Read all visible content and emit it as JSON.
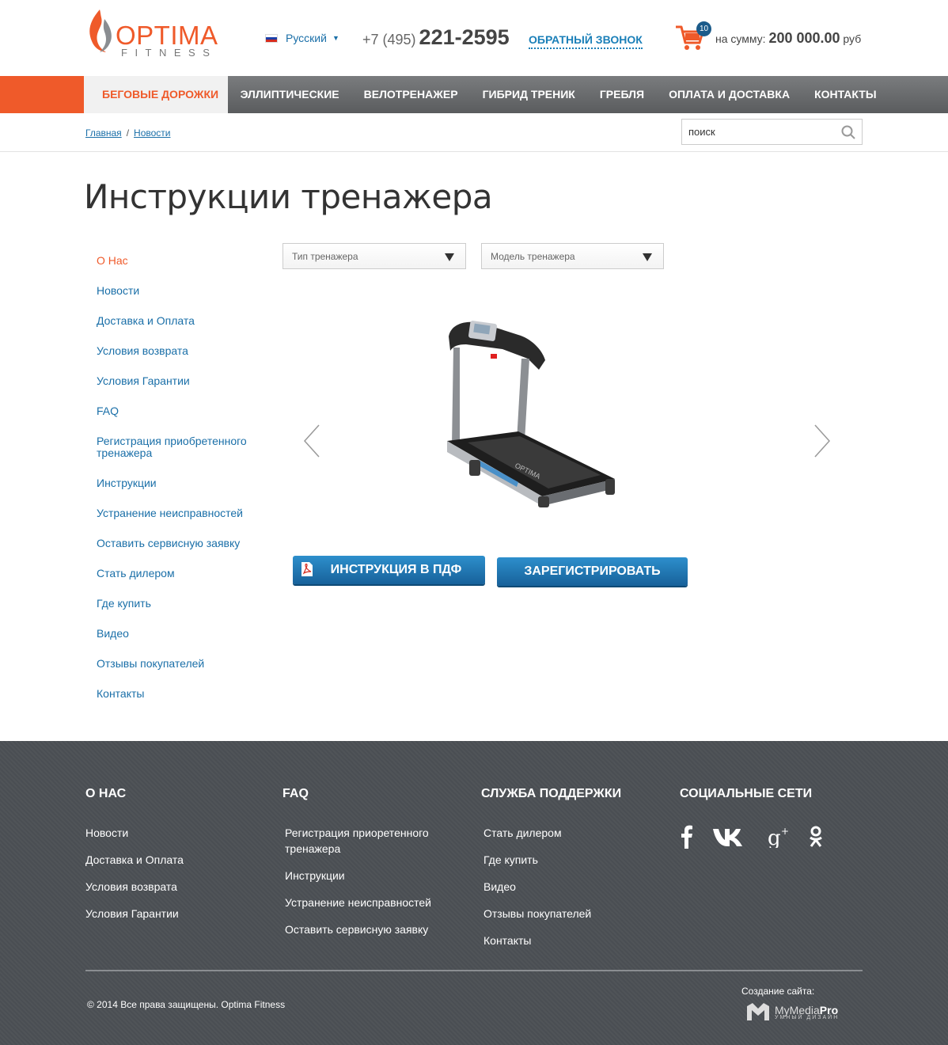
{
  "header": {
    "logo_word": "OPTIMA",
    "logo_sub": "FITNESS",
    "language": "Русский",
    "phone_code": "+7 (495)",
    "phone_number": "221-2595",
    "callback_label": "ОБРАТНЫЙ ЗВОНОК",
    "cart_count": "10",
    "cart_sum_label": "на сумму:",
    "cart_sum_value": "200 000.00",
    "cart_currency": "руб"
  },
  "nav": {
    "items": [
      {
        "label": "БЕГОВЫЕ ДОРОЖКИ",
        "active": true
      },
      {
        "label": "ЭЛЛИПТИЧЕСКИЕ"
      },
      {
        "label": "ВЕЛОТРЕНАЖЕР"
      },
      {
        "label": "ГИБРИД ТРЕНИК"
      },
      {
        "label": "ГРЕБЛЯ"
      },
      {
        "label": "ОПЛАТА И ДОСТАВКА"
      },
      {
        "label": "КОНТАКТЫ"
      }
    ]
  },
  "breadcrumb": {
    "items": [
      "Главная",
      "Новости"
    ],
    "separator": "/"
  },
  "search": {
    "placeholder": "поиск"
  },
  "page": {
    "title": "Инструкции тренажера"
  },
  "sidebar": {
    "items": [
      "О Нас",
      "Новости",
      "Доставка и Оплата",
      "Условия возврата",
      "Условия Гарантии",
      "FAQ",
      "Регистрация приобретенного тренажера",
      "Инструкции",
      "Устранение неисправностей",
      "Оставить сервисную заявку",
      "Стать дилером",
      "Где купить",
      "Видео",
      "Отзывы покупателей",
      "Контакты"
    ]
  },
  "filters": {
    "type_select": "Тип тренажера",
    "model_select": "Модель тренажера"
  },
  "product": {
    "brand_on_deck": "OPTIMA"
  },
  "buttons": {
    "pdf": "ИНСТРУКЦИЯ В ПДФ",
    "register": "ЗАРЕГИСТРИРОВАТЬ"
  },
  "footer": {
    "col1": {
      "heading": "О НАС",
      "links": [
        "Новости",
        "Доставка и Оплата",
        "Условия возврата",
        "Условия Гарантии"
      ]
    },
    "col2": {
      "heading": "FAQ",
      "links": [
        "Регистрация приоретенного тренажера",
        "Инструкции",
        "Устранение неисправностей",
        "Оставить сервисную заявку"
      ]
    },
    "col3": {
      "heading": "СЛУЖБА ПОДДЕРЖКИ",
      "links": [
        "Стать дилером",
        "Где купить",
        "Видео",
        "Отзывы покупателей",
        "Контакты"
      ]
    },
    "col4": {
      "heading": "СОЦИАЛЬНЫЕ СЕТИ"
    },
    "social_icons": [
      "facebook-icon",
      "vk-icon",
      "google-plus-icon",
      "odnoklassniki-icon"
    ],
    "copyright": "© 2014 Все права защищены. Optima Fitness",
    "made_by_label": "Создание сайта:",
    "studio_name_a": "MyMedia",
    "studio_name_b": "Pro",
    "studio_tagline": "УМНЫЙ ДИЗАЙН"
  },
  "colors": {
    "accent": "#ef5a2a",
    "link": "#1a6fa8",
    "button": "#1f75b0",
    "footer_bg": "#4a4e53"
  }
}
